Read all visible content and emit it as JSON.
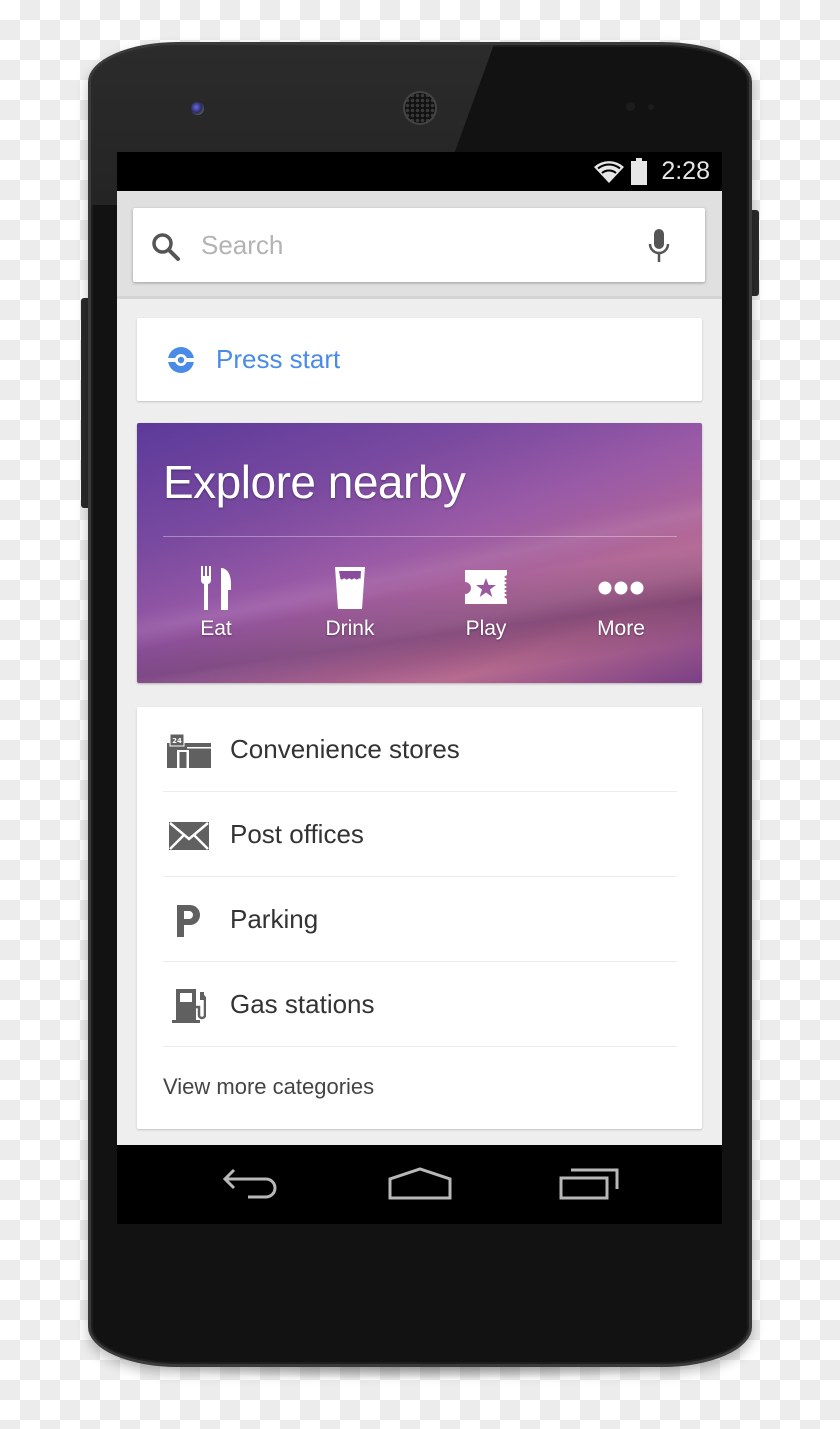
{
  "status_bar": {
    "time": "2:28",
    "icons": [
      "wifi-icon",
      "battery-icon"
    ]
  },
  "search": {
    "placeholder": "Search",
    "value": "",
    "left_icon": "search-icon",
    "right_icon": "mic-icon"
  },
  "press_start": {
    "icon": "pokeball-icon",
    "label": "Press start",
    "color": "#4a8be8"
  },
  "explore": {
    "title": "Explore nearby",
    "actions": [
      {
        "label": "Eat",
        "icon": "fork-knife-icon"
      },
      {
        "label": "Drink",
        "icon": "glass-icon"
      },
      {
        "label": "Play",
        "icon": "ticket-star-icon"
      },
      {
        "label": "More",
        "icon": "more-dots-icon"
      }
    ],
    "colors": {
      "start": "#5c3a9a",
      "end": "#b66a8e"
    }
  },
  "places": {
    "items": [
      {
        "label": "Convenience stores",
        "icon": "convenience-store-24-icon"
      },
      {
        "label": "Post offices",
        "icon": "envelope-icon"
      },
      {
        "label": "Parking",
        "icon": "parking-icon"
      },
      {
        "label": "Gas stations",
        "icon": "gas-pump-icon"
      }
    ],
    "view_more": "View more categories"
  },
  "nav_bar": {
    "buttons": [
      "back-icon",
      "home-icon",
      "recents-icon"
    ]
  }
}
